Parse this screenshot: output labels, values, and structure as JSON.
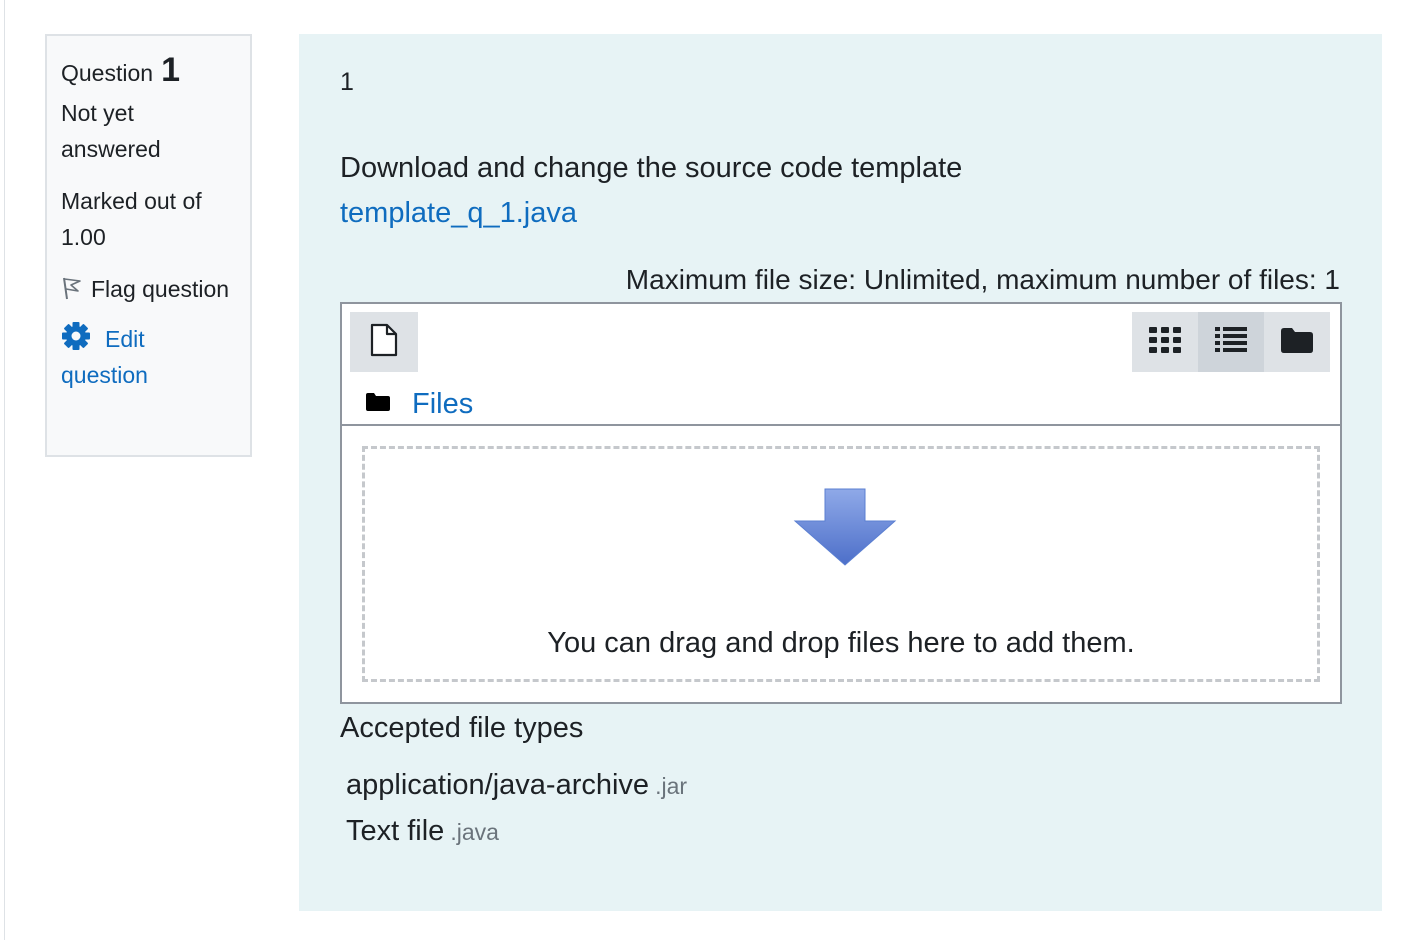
{
  "info": {
    "question_label": "Question",
    "question_number": "1",
    "state": "Not yet answered",
    "grade": "Marked out of 1.00",
    "flag_label": "Flag question",
    "edit_label": "Edit question"
  },
  "question": {
    "number_text": "1",
    "prompt": "Download and change the source code template",
    "template_link": "template_q_1.java"
  },
  "filemanager": {
    "limits": "Maximum file size: Unlimited, maximum number of files: 1",
    "path_label": "Files",
    "drop_message": "You can drag and drop files here to add them.",
    "active_view": "list"
  },
  "accepted": {
    "title": "Accepted file types",
    "types": [
      {
        "name": "application/java-archive",
        "ext": ".jar"
      },
      {
        "name": "Text file",
        "ext": ".java"
      }
    ]
  },
  "colors": {
    "link": "#0f6cbf",
    "content_bg": "#e7f3f5",
    "info_bg": "#f8f9fa",
    "arrow": "#5b7fd1"
  },
  "icons": [
    "flag-icon",
    "gear-icon",
    "add-file-icon",
    "icons-view-icon",
    "list-view-icon",
    "tree-view-icon",
    "folder-icon",
    "drop-arrow-icon"
  ]
}
